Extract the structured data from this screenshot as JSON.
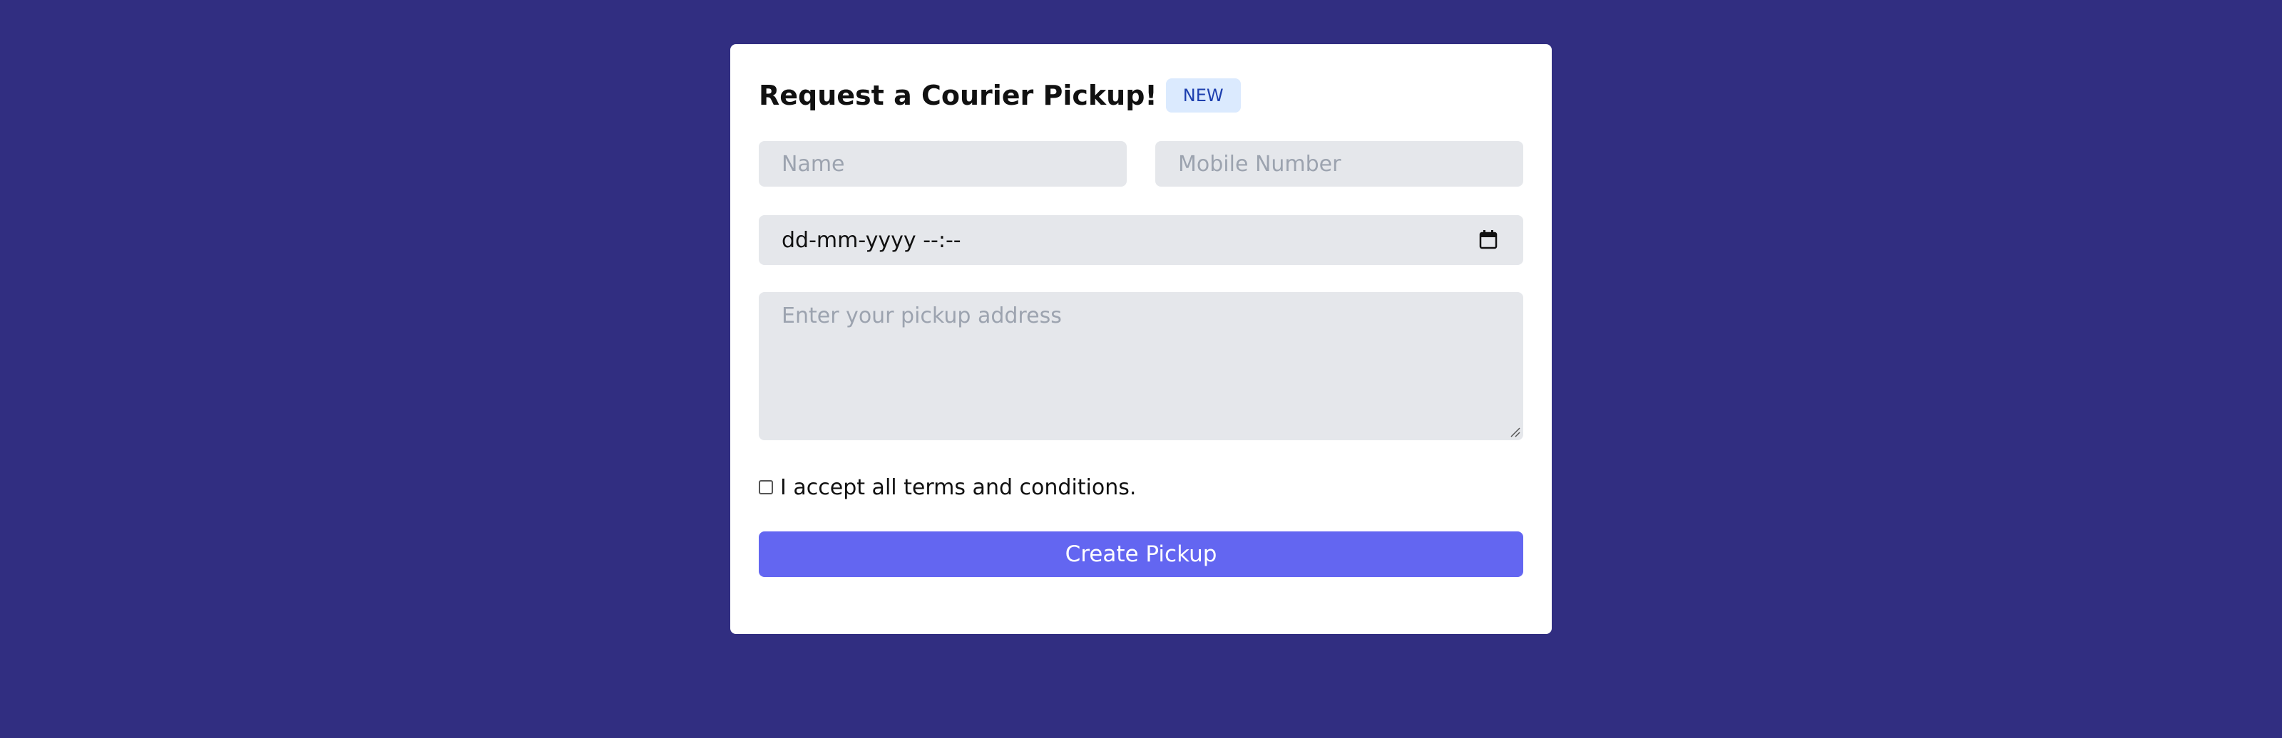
{
  "form": {
    "title": "Request a Courier Pickup!",
    "badge": "NEW",
    "name_placeholder": "Name",
    "mobile_placeholder": "Mobile Number",
    "datetime_value": "dd-mm-yyyy --:--",
    "address_placeholder": "Enter your pickup address",
    "terms_label": "I accept all terms and conditions.",
    "terms_checked": false,
    "submit_label": "Create Pickup"
  },
  "colors": {
    "background": "#312e81",
    "card": "#ffffff",
    "field": "#e5e7eb",
    "button": "#6366f1",
    "badge_bg": "#dbeafe",
    "badge_text": "#1e40af"
  },
  "icons": {
    "datetime": "calendar-icon",
    "textarea_handle": "resize-handle-icon"
  }
}
